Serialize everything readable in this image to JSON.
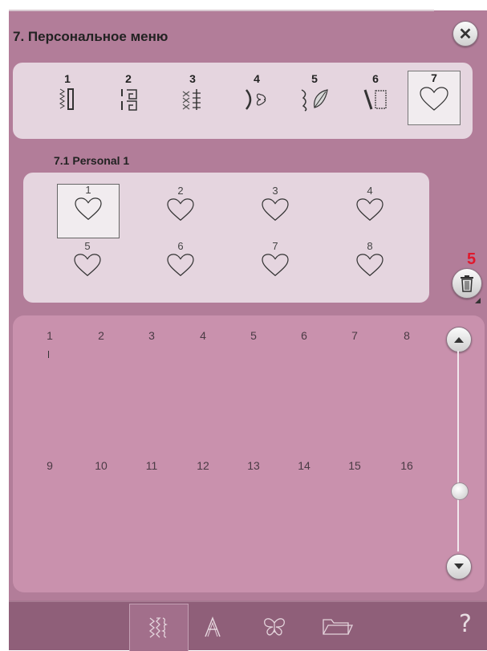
{
  "header": {
    "title": "7. Персональное меню",
    "close_icon": "close-icon"
  },
  "categories": [
    {
      "number": "1",
      "icon": "buttonhole-stitch-icon"
    },
    {
      "number": "2",
      "icon": "decorative-stitch-icon"
    },
    {
      "number": "3",
      "icon": "cross-stitch-icon"
    },
    {
      "number": "4",
      "icon": "heart-scallop-stitch-icon"
    },
    {
      "number": "5",
      "icon": "leaf-stitch-icon"
    },
    {
      "number": "6",
      "icon": "quilt-stitch-icon"
    },
    {
      "number": "7",
      "icon": "heart-icon",
      "selected": true
    }
  ],
  "submenu": {
    "title": "7.1 Personal 1",
    "items": [
      {
        "number": "1",
        "selected": true
      },
      {
        "number": "2"
      },
      {
        "number": "3"
      },
      {
        "number": "4"
      },
      {
        "number": "5"
      },
      {
        "number": "6"
      },
      {
        "number": "7"
      },
      {
        "number": "8"
      }
    ]
  },
  "delete": {
    "badge": "5",
    "icon": "trash-icon"
  },
  "sequence": {
    "row1": [
      "1",
      "2",
      "3",
      "4",
      "5",
      "6",
      "7",
      "8"
    ],
    "row2": [
      "9",
      "10",
      "11",
      "12",
      "13",
      "14",
      "15",
      "16"
    ]
  },
  "bottom_tabs": [
    {
      "icon": "stitch-menu-icon",
      "selected": true
    },
    {
      "icon": "font-icon"
    },
    {
      "icon": "butterfly-icon"
    },
    {
      "icon": "folder-icon"
    }
  ],
  "help_icon": "help-icon",
  "colors": {
    "background": "#b27d99",
    "panel": "#e5d5df",
    "sequence_panel": "#c991ad",
    "bottom_bar": "#8f5f79",
    "badge": "#e0182c"
  }
}
